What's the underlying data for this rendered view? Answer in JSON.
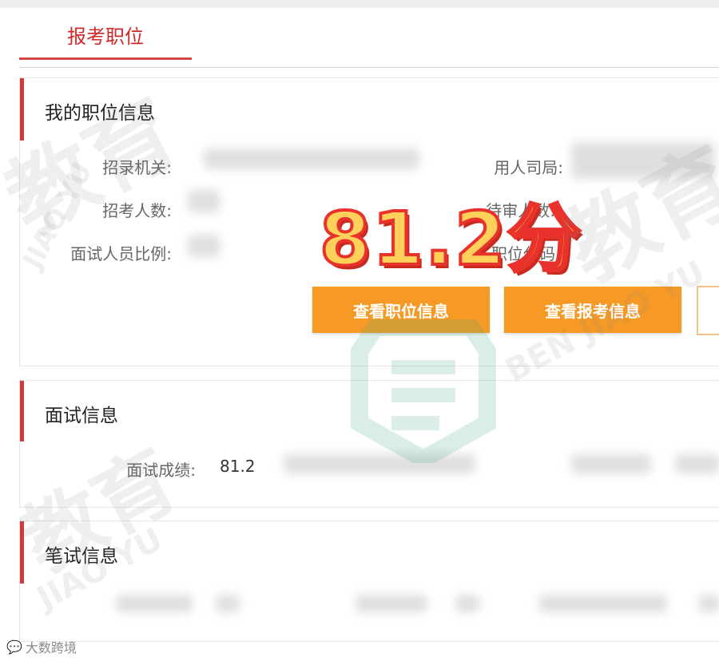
{
  "tab": {
    "label": "报考职位"
  },
  "position_panel": {
    "title": "我的职位信息",
    "labels": {
      "agency": "招录机关:",
      "bureau": "用人司局:",
      "recruit_count": "招考人数:",
      "pending_count": "待审人数:",
      "ratio": "面试人员比例:",
      "code": "职位代码"
    },
    "buttons": {
      "view_position": "查看职位信息",
      "view_application": "查看报考信息"
    }
  },
  "overlay": {
    "score_text": "81.2分"
  },
  "interview_panel": {
    "title": "面试信息",
    "score_label": "面试成绩:",
    "score_value": "81.2"
  },
  "written_panel": {
    "title": "笔试信息"
  },
  "watermarks": {
    "brand_cn": "教育",
    "brand_pinyin_1": "BEN JIAO YU",
    "brand_pinyin_2": "JIAO YU",
    "footer": "大数跨境"
  },
  "colors": {
    "accent_red": "#d23a3a",
    "tab_red": "#cf2a2a",
    "button_orange": "#f79a25",
    "score_yellow": "#ffd15a"
  }
}
